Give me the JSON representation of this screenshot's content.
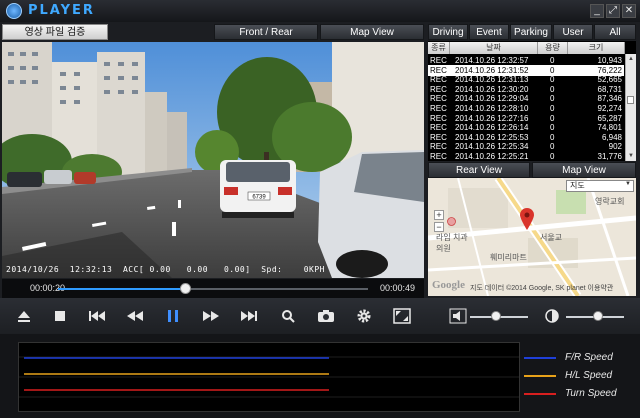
{
  "app": {
    "title": "PLAYER",
    "logo_letter": "E"
  },
  "window_controls": {
    "minimize": "_",
    "maximize": "⤢",
    "close": "✕"
  },
  "video_tabs": {
    "file_verify": "영상 파일 검증",
    "front_rear": "Front / Rear",
    "map_view": "Map View"
  },
  "list_tabs": [
    "Driving",
    "Event",
    "Parking",
    "User",
    "All"
  ],
  "file_list": {
    "columns": [
      "종류",
      "날짜",
      "용량",
      "크기"
    ],
    "rows": [
      {
        "type": "REC",
        "date": "2014.10.26 12:32:57",
        "cap": "0",
        "size": "10,943"
      },
      {
        "type": "REC",
        "date": "2014.10.26 12:31:52",
        "cap": "0",
        "size": "76,222",
        "selected": true
      },
      {
        "type": "REC",
        "date": "2014.10.26 12:31:13",
        "cap": "0",
        "size": "52,665"
      },
      {
        "type": "REC",
        "date": "2014.10.26 12:30:20",
        "cap": "0",
        "size": "68,731"
      },
      {
        "type": "REC",
        "date": "2014.10.26 12:29:04",
        "cap": "0",
        "size": "87,346"
      },
      {
        "type": "REC",
        "date": "2014.10.26 12:28:10",
        "cap": "0",
        "size": "92,274"
      },
      {
        "type": "REC",
        "date": "2014.10.26 12:27:16",
        "cap": "0",
        "size": "65,287"
      },
      {
        "type": "REC",
        "date": "2014.10.26 12:26:14",
        "cap": "0",
        "size": "74,801"
      },
      {
        "type": "REC",
        "date": "2014.10.26 12:25:53",
        "cap": "0",
        "size": "6,948"
      },
      {
        "type": "REC",
        "date": "2014.10.26 12:25:34",
        "cap": "0",
        "size": "902"
      },
      {
        "type": "REC",
        "date": "2014.10.26 12:25:21",
        "cap": "0",
        "size": "31,776"
      }
    ]
  },
  "map_tabs": {
    "rear_view": "Rear View",
    "map_view": "Map View"
  },
  "map": {
    "dropdown": "지도",
    "zoom_in": "+",
    "zoom_out": "−",
    "labels": [
      "영락교회",
      "라임 치과의원",
      "훼미리마트",
      "서울교"
    ],
    "copyright": "지도 데이터 ©2014 Google, SK planet   이용약관",
    "google": "Google"
  },
  "osd": {
    "text": "2014/10/26  12:32:13  ACC[ 0.00   0.00   0.00]  Spd:    0KPH",
    "car_plate": "6739"
  },
  "playback": {
    "current": "00:00:20",
    "total": "00:00:49",
    "progress": 0.41
  },
  "toolbar": {
    "icons": [
      "eject-icon",
      "stop-icon",
      "skip-back-icon",
      "rewind-icon",
      "pause-icon",
      "fast-forward-icon",
      "skip-forward-icon",
      "zoom-icon",
      "camera-icon",
      "settings-icon",
      "fullscreen-icon"
    ],
    "volume_level": 0.45,
    "brightness_level": 0.55
  },
  "graph": {
    "legend": [
      {
        "label": "F/R Speed",
        "color": "#1f3fd8"
      },
      {
        "label": "H/L Speed",
        "color": "#e8a21a"
      },
      {
        "label": "Turn Speed",
        "color": "#d81f1f"
      }
    ]
  },
  "colors": {
    "accent": "#2f9bff",
    "selected_row": "#ffffff"
  }
}
